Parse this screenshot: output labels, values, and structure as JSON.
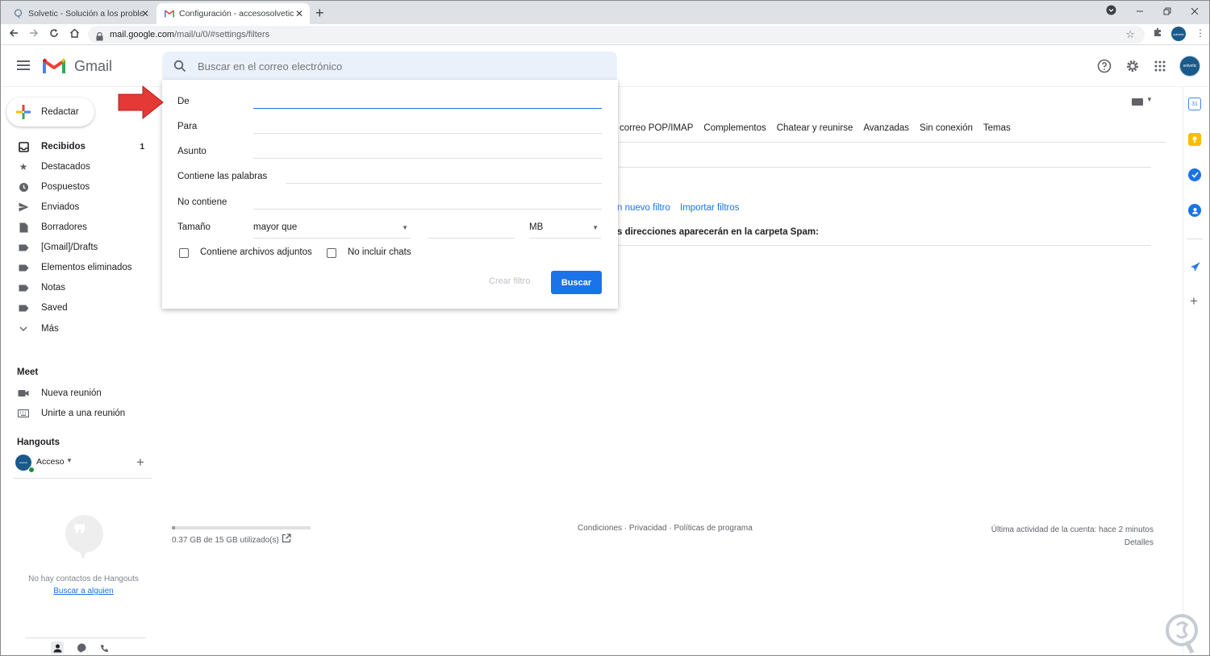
{
  "browser": {
    "tabs": [
      {
        "title": "Solvetic - Solución a los problem",
        "close": "✕"
      },
      {
        "title": "Configuración - accesosolvetic1(",
        "close": "✕"
      }
    ],
    "new_tab": "+",
    "url_host": "mail.google.com",
    "url_path": "/mail/u/0/#settings/filters",
    "avatar_text": "solvetic"
  },
  "gmail": {
    "brand": "Gmail",
    "search_placeholder": "Buscar en el correo electrónico",
    "avatar_text": "solvetic"
  },
  "sidebar": {
    "compose_label": "Redactar",
    "items": [
      {
        "label": "Recibidos",
        "count": "1",
        "icon": "inbox-icon"
      },
      {
        "label": "Destacados",
        "count": "",
        "icon": "star-icon"
      },
      {
        "label": "Pospuestos",
        "count": "",
        "icon": "clock-icon"
      },
      {
        "label": "Enviados",
        "count": "",
        "icon": "send-icon"
      },
      {
        "label": "Borradores",
        "count": "",
        "icon": "draft-icon"
      },
      {
        "label": "[Gmail]/Drafts",
        "count": "",
        "icon": "label-icon"
      },
      {
        "label": "Elementos eliminados",
        "count": "",
        "icon": "label-icon"
      },
      {
        "label": "Notas",
        "count": "",
        "icon": "label-icon"
      },
      {
        "label": "Saved",
        "count": "",
        "icon": "label-icon"
      },
      {
        "label": "Más",
        "count": "",
        "icon": "chevron-down-icon"
      }
    ],
    "meet": {
      "title": "Meet",
      "new_meeting": "Nueva reunión",
      "join_meeting": "Unirte a una reunión"
    },
    "hangouts": {
      "title": "Hangouts",
      "user": "Acceso",
      "no_contacts": "No hay contactos de Hangouts",
      "find_someone": "Buscar a alguien"
    }
  },
  "settings": {
    "tabs": [
      "correo POP/IMAP",
      "Complementos",
      "Chatear y reunirse",
      "Avanzadas",
      "Sin conexión",
      "Temas"
    ],
    "new_filter_link": "n nuevo filtro",
    "import_filters_link": "Importar filtros",
    "spam_text": "s direcciones aparecerán en la carpeta Spam:"
  },
  "search_options": {
    "from_label": "De",
    "to_label": "Para",
    "subject_label": "Asunto",
    "has_words_label": "Contiene las palabras",
    "not_has_label": "No contiene",
    "size_label": "Tamaño",
    "size_operator": "mayor que",
    "size_unit": "MB",
    "has_attachment_label": "Contiene archivos adjuntos",
    "no_chats_label": "No incluir chats",
    "create_filter_label": "Crear filtro",
    "search_button_label": "Buscar"
  },
  "footer": {
    "storage_used_fraction": 0.025,
    "storage_text": "0.37 GB de 15 GB utilizado(s)",
    "links": "Condiciones · Privacidad · Políticas de programa",
    "last_activity": "Última actividad de la cuenta: hace 2 minutos",
    "details": "Detalles"
  },
  "colors": {
    "accent": "#1a73e8",
    "annotation_arrow": "#e53935"
  }
}
